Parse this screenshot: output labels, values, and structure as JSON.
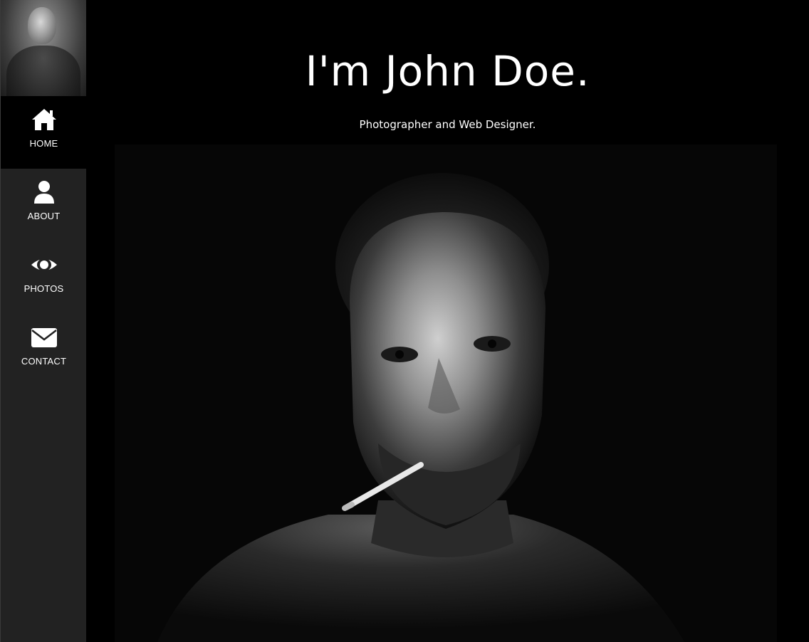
{
  "sidebar": {
    "avatar_icon": "profile-photo",
    "items": [
      {
        "label": "HOME",
        "icon": "home-icon",
        "active": true
      },
      {
        "label": "ABOUT",
        "icon": "user-icon",
        "active": false
      },
      {
        "label": "PHOTOS",
        "icon": "eye-icon",
        "active": false
      },
      {
        "label": "CONTACT",
        "icon": "envelope-icon",
        "active": false
      }
    ]
  },
  "main": {
    "title": "I'm John Doe.",
    "subtitle": "Photographer and Web Designer."
  },
  "colors": {
    "sidebar_bg": "#222222",
    "active_bg": "#000000",
    "page_bg": "#000000",
    "text": "#ffffff"
  }
}
